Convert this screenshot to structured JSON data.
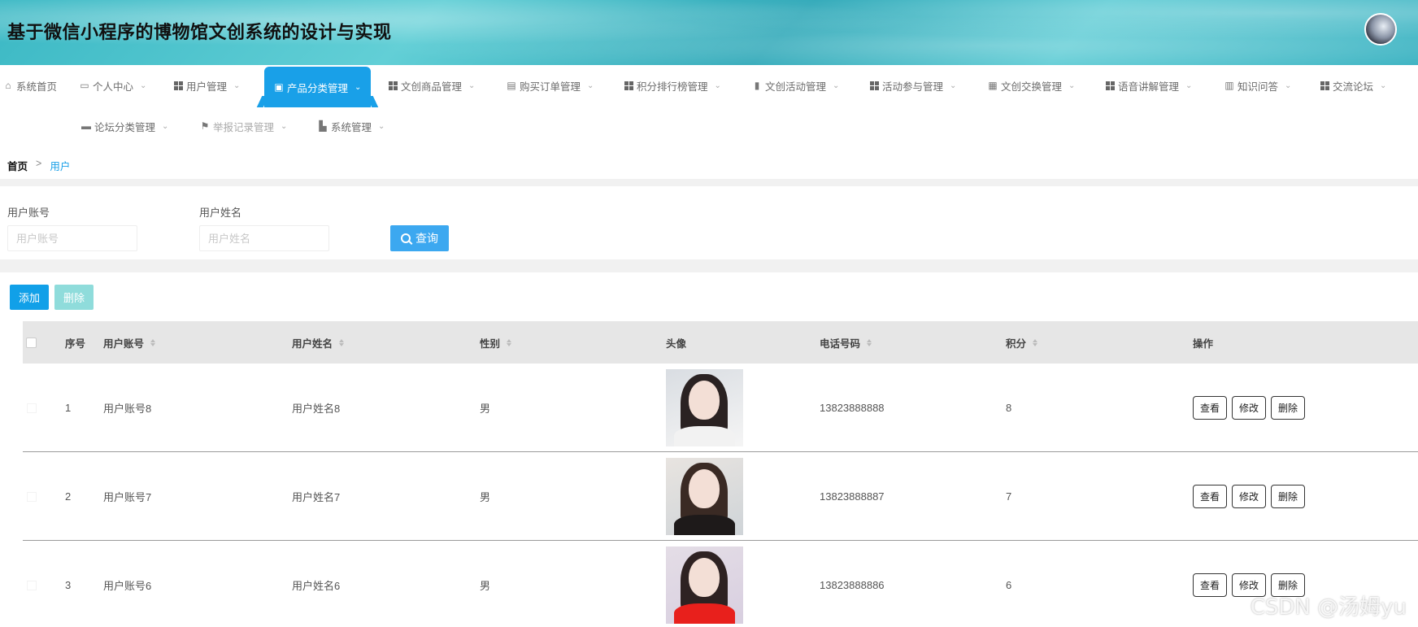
{
  "header": {
    "title": "基于微信小程序的博物馆文创系统的设计与实现"
  },
  "nav": {
    "row1": [
      {
        "label": "系统首页",
        "icon": "home-icon",
        "chevron": false
      },
      {
        "label": "个人中心",
        "icon": "card-icon",
        "chevron": true
      },
      {
        "label": "用户管理",
        "icon": "grid-icon",
        "chevron": true
      },
      {
        "label": "产品分类管理",
        "icon": "chat-icon",
        "chevron": true,
        "active": true
      },
      {
        "label": "文创商品管理",
        "icon": "grid-icon",
        "chevron": true
      },
      {
        "label": "购买订单管理",
        "icon": "bag-icon",
        "chevron": true
      },
      {
        "label": "积分排行榜管理",
        "icon": "grid-icon",
        "chevron": true
      },
      {
        "label": "文创活动管理",
        "icon": "clipboard-icon",
        "chevron": true
      },
      {
        "label": "活动参与管理",
        "icon": "grid-icon",
        "chevron": true
      },
      {
        "label": "文创交换管理",
        "icon": "apps-icon",
        "chevron": true
      },
      {
        "label": "语音讲解管理",
        "icon": "grid-icon",
        "chevron": true
      },
      {
        "label": "知识问答",
        "icon": "book-icon",
        "chevron": true
      },
      {
        "label": "交流论坛",
        "icon": "grid-icon",
        "chevron": true
      }
    ],
    "row2": [
      {
        "label": "论坛分类管理",
        "icon": "monitor-icon",
        "chevron": true
      },
      {
        "label": "举报记录管理",
        "icon": "flag-icon",
        "chevron": true
      },
      {
        "label": "系统管理",
        "icon": "briefcase-icon",
        "chevron": true
      }
    ]
  },
  "breadcrumb": {
    "home": "首页",
    "sep": ">",
    "current": "用户"
  },
  "search": {
    "account_label": "用户账号",
    "account_placeholder": "用户账号",
    "name_label": "用户姓名",
    "name_placeholder": "用户姓名",
    "query_label": "查询"
  },
  "actions": {
    "add": "添加",
    "delete": "删除"
  },
  "table": {
    "columns": [
      "序号",
      "用户账号",
      "用户姓名",
      "性别",
      "头像",
      "电话号码",
      "积分",
      "操作"
    ],
    "rows": [
      {
        "index": "1",
        "account": "用户账号8",
        "name": "用户姓名8",
        "gender": "男",
        "phone": "13823888888",
        "points": "8"
      },
      {
        "index": "2",
        "account": "用户账号7",
        "name": "用户姓名7",
        "gender": "男",
        "phone": "13823888887",
        "points": "7"
      },
      {
        "index": "3",
        "account": "用户账号6",
        "name": "用户姓名6",
        "gender": "男",
        "phone": "13823888886",
        "points": "6"
      }
    ],
    "op_labels": {
      "view": "查看",
      "edit": "修改",
      "delete": "删除"
    }
  },
  "watermark": "CSDN @汤姆yu",
  "colors": {
    "accent": "#19a0e8",
    "query_btn": "#3ca8f0",
    "delete_btn": "#8fdcdb"
  }
}
